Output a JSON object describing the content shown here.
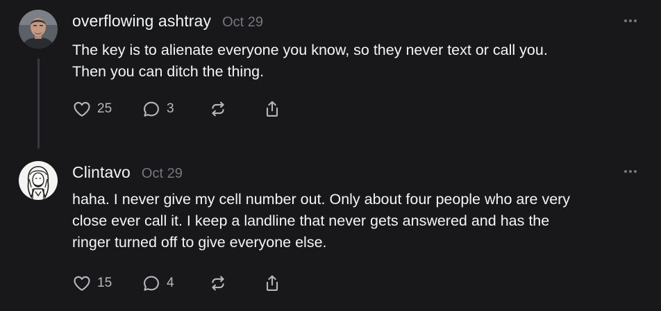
{
  "posts": [
    {
      "author": "overflowing ashtray",
      "date": "Oct 29",
      "text": "The key is to alienate everyone you know, so they never text or call you.\nThen you can ditch the thing.",
      "likes": "25",
      "replies": "3",
      "avatar_icon": "user-photo-avatar",
      "has_thread_line": true
    },
    {
      "author": "Clintavo",
      "date": "Oct 29",
      "text": "haha. I never give my cell number out. Only about four people who are very\nclose ever call it. I keep a landline that never gets answered and has the\nringer turned off to give everyone else.",
      "likes": "15",
      "replies": "4",
      "avatar_icon": "sketch-portrait-avatar",
      "has_thread_line": false
    }
  ],
  "icons": {
    "like": "heart-icon",
    "reply": "comment-bubble-icon",
    "repost": "repost-arrows-icon",
    "share": "share-upload-icon",
    "more": "more-dots-icon"
  },
  "colors": {
    "background": "#18181a",
    "text": "#f3f5f7",
    "muted": "#77777c",
    "icon": "#b8b8bc"
  }
}
